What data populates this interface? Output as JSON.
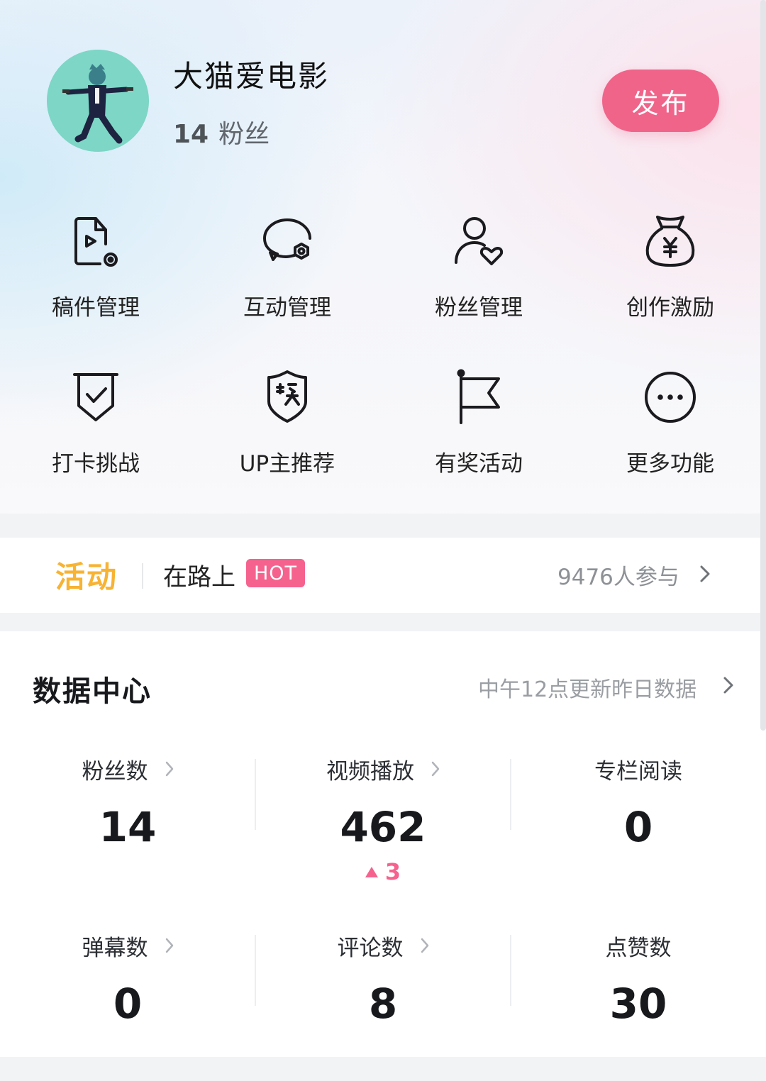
{
  "profile": {
    "username": "大猫爱电影",
    "fans_count": "14",
    "fans_label": "粉丝",
    "publish_label": "发布"
  },
  "tools": [
    {
      "label": "稿件管理",
      "icon": "manuscript-icon"
    },
    {
      "label": "互动管理",
      "icon": "comment-settings-icon"
    },
    {
      "label": "粉丝管理",
      "icon": "user-heart-icon"
    },
    {
      "label": "创作激励",
      "icon": "money-bag-icon"
    },
    {
      "label": "打卡挑战",
      "icon": "check-shield-icon"
    },
    {
      "label": "UP主推荐",
      "icon": "award-badge-icon"
    },
    {
      "label": "有奖活动",
      "icon": "flag-icon"
    },
    {
      "label": "更多功能",
      "icon": "more-circle-icon"
    }
  ],
  "activity": {
    "tag": "活动",
    "title": "在路上",
    "badge": "HOT",
    "participants": "9476人参与"
  },
  "data_center": {
    "title": "数据中心",
    "update_note": "中午12点更新昨日数据",
    "stats": [
      {
        "name": "粉丝数",
        "value": "14",
        "has_arrow": true
      },
      {
        "name": "视频播放",
        "value": "462",
        "delta": "3",
        "has_arrow": true
      },
      {
        "name": "专栏阅读",
        "value": "0",
        "has_arrow": false
      },
      {
        "name": "弹幕数",
        "value": "0",
        "has_arrow": true
      },
      {
        "name": "评论数",
        "value": "8",
        "has_arrow": true
      },
      {
        "name": "点赞数",
        "value": "30",
        "has_arrow": false
      }
    ]
  },
  "colors": {
    "accent_pink": "#f0648a",
    "activity_orange": "#f7b333",
    "hot_badge": "#f5628e"
  }
}
